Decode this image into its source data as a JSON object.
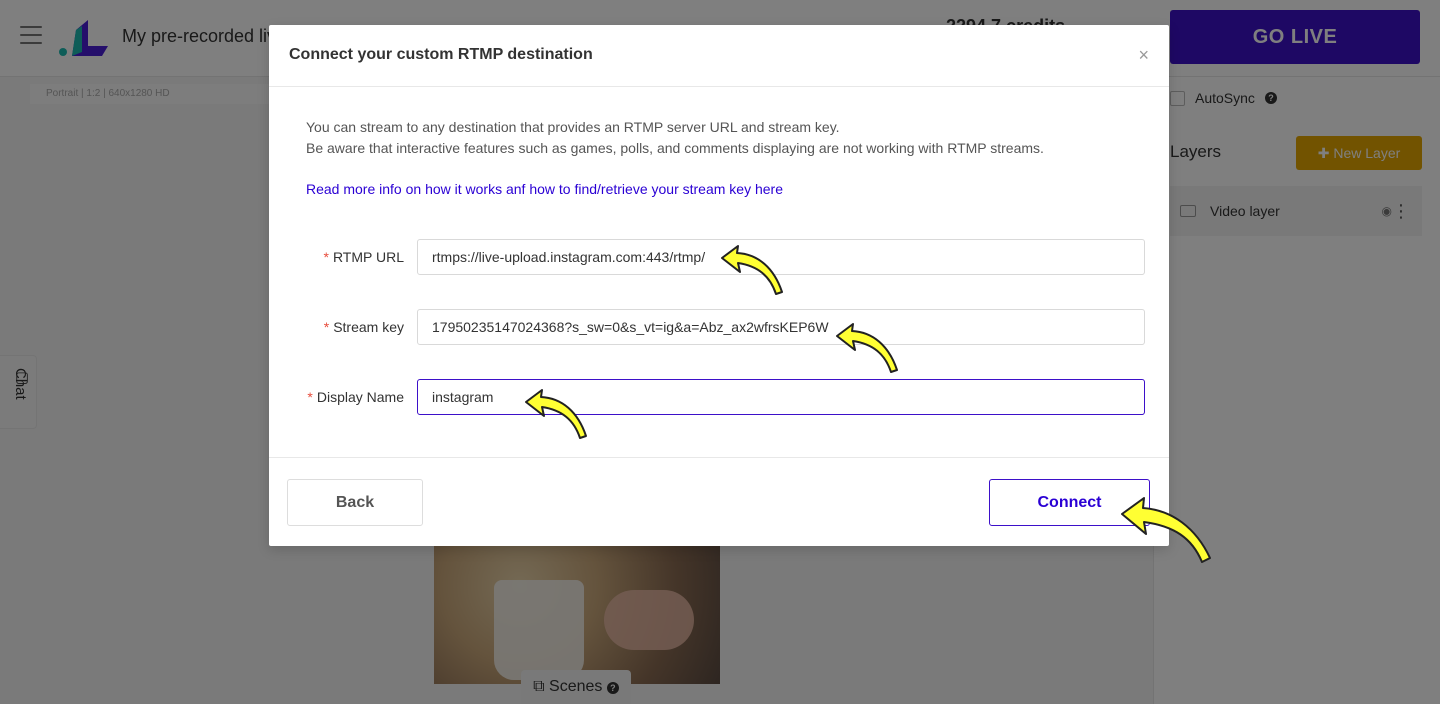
{
  "app": {
    "project_title": "My pre-recorded live",
    "credits": "2294.7 credits",
    "go_live_label": "GO LIVE",
    "resolution_label": "Portrait | 1:2 | 640x1280 HD",
    "scenes_label": "Scenes",
    "chat_label": "Chat"
  },
  "right_panel": {
    "autosync_label": "AutoSync",
    "layers_title": "Layers",
    "new_layer_label": "New Layer",
    "layer_items": [
      {
        "label": "Video layer"
      }
    ]
  },
  "modal": {
    "title": "Connect your custom RTMP destination",
    "close_glyph": "×",
    "description_line1": "You can stream to any destination that provides an RTMP server URL and stream key.",
    "description_line2": "Be aware that interactive features such as games, polls, and comments displaying are not working with RTMP streams.",
    "read_more_link": "Read more info on how it works anf how to find/retrieve your stream key here",
    "fields": {
      "rtmp_url": {
        "label": "RTMP URL",
        "value": "rtmps://live-upload.instagram.com:443/rtmp/"
      },
      "stream_key": {
        "label": "Stream key",
        "value": "17950235147024368?s_sw=0&s_vt=ig&a=Abz_ax2wfrsKEP6W"
      },
      "display_name": {
        "label": "Display Name",
        "value": "instagram"
      }
    },
    "required_marker": "*",
    "back_label": "Back",
    "connect_label": "Connect"
  },
  "colors": {
    "brand": "#3d10c9",
    "link": "#2a00d4",
    "new_layer": "#e4a700",
    "annotation_arrow": "#ffff33"
  },
  "icons": [
    "hamburger-icon",
    "logo-icon",
    "close-icon",
    "help-icon",
    "plus-icon",
    "camera-icon",
    "eye-icon",
    "more-vertical-icon",
    "scenes-icon",
    "chat-icon",
    "annotation-arrow-icon"
  ]
}
